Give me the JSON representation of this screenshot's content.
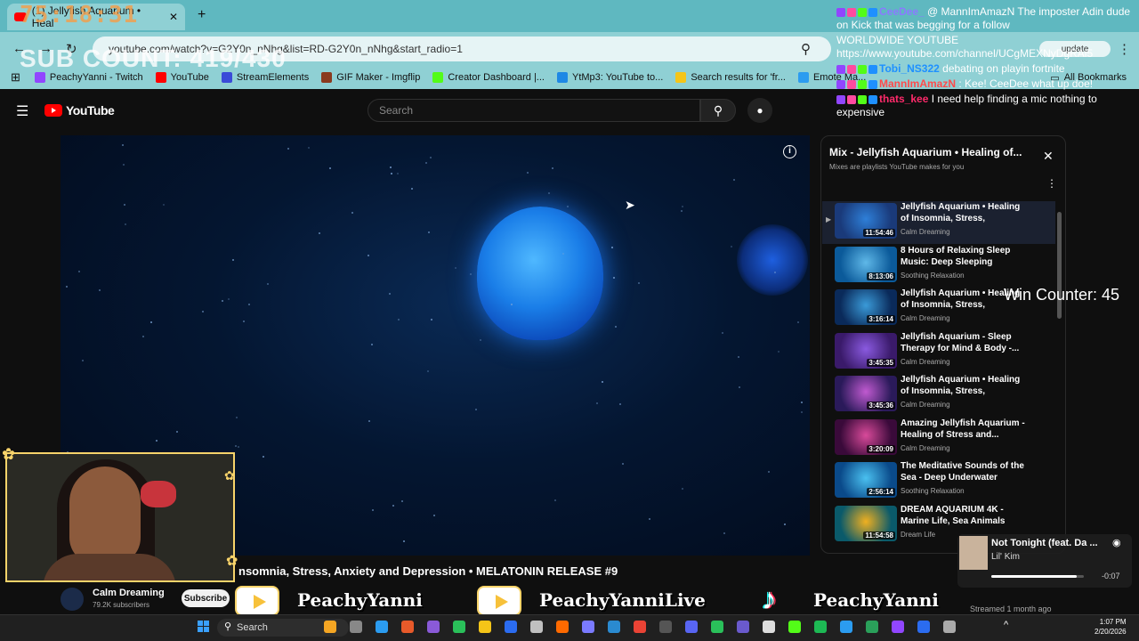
{
  "browser": {
    "tab_title": "(1) Jellyfish Aquarium • Heal",
    "url": "youtube.com/watch?v=G2Y0n_nNhg&list=RD-G2Y0n_nNhg&start_radio=1",
    "update_label": "update",
    "bookmarks": [
      {
        "label": "PeachyYanni - Twitch",
        "color": "#9146ff"
      },
      {
        "label": "YouTube",
        "color": "#ff0000"
      },
      {
        "label": "StreamElements",
        "color": "#3a4bd8"
      },
      {
        "label": "GIF Maker - Imgflip",
        "color": "#8a3a1e"
      },
      {
        "label": "Creator Dashboard |...",
        "color": "#53fc18"
      },
      {
        "label": "YtMp3: YouTube to...",
        "color": "#1e88e5"
      },
      {
        "label": "Search results for 'fr...",
        "color": "#f5c518"
      },
      {
        "label": "Emote Ma...",
        "color": "#2b9cf0"
      }
    ],
    "all_bookmarks": "All Bookmarks"
  },
  "youtube": {
    "logo_text": "YouTube",
    "search_placeholder": "Search",
    "video_title": "nsomnia, Stress, Anxiety and Depression • MELATONIN RELEASE #9",
    "channel_name": "Calm Dreaming",
    "channel_subs": "79.2K subscribers",
    "subscribe_label": "Subscribe"
  },
  "playlist": {
    "title": "Mix - Jellyfish Aquarium • Healing of...",
    "subtitle": "Mixes are playlists YouTube makes for you",
    "items": [
      {
        "title": "Jellyfish Aquarium • Healing of Insomnia, Stress, Anxiety...",
        "channel": "Calm Dreaming",
        "duration": "11:54:46",
        "c1": "#1a3a7a",
        "c2": "#2e7fd8"
      },
      {
        "title": "8 Hours of Relaxing Sleep Music: Deep Sleeping Music,...",
        "channel": "Soothing Relaxation",
        "duration": "8:13:06",
        "c1": "#0b5a9a",
        "c2": "#5fb8e8"
      },
      {
        "title": "Jellyfish Aquarium • Healing of Insomnia, Stress, Anxiety...",
        "channel": "Calm Dreaming",
        "duration": "3:16:14",
        "c1": "#0a2a5a",
        "c2": "#3a9ad8"
      },
      {
        "title": "Jellyfish Aquarium - Sleep Therapy for Mind & Body -...",
        "channel": "Calm Dreaming",
        "duration": "3:45:35",
        "c1": "#3a1a6a",
        "c2": "#8a5ae0"
      },
      {
        "title": "Jellyfish Aquarium • Healing of Insomnia, Stress, Anxiety...",
        "channel": "Calm Dreaming",
        "duration": "3:45:36",
        "c1": "#2a1a5a",
        "c2": "#c05ad0"
      },
      {
        "title": "Amazing Jellyfish Aquarium - Healing of Stress and...",
        "channel": "Calm Dreaming",
        "duration": "3:20:09",
        "c1": "#3a0a3a",
        "c2": "#d84a9a"
      },
      {
        "title": "The Meditative Sounds of the Sea - Deep Underwater",
        "channel": "Soothing Relaxation",
        "duration": "2:56:14",
        "c1": "#0a4a8a",
        "c2": "#4ac0f0"
      },
      {
        "title": "DREAM AQUARIUM 4K - Marine Life, Sea Animals and...",
        "channel": "Dream Life",
        "duration": "11:54:58",
        "c1": "#0a5a6a",
        "c2": "#f0b020"
      }
    ]
  },
  "overlay": {
    "timer": "75:18:31",
    "sub_count": "SUB COUNT: 419/430",
    "win_counter": "Win Counter: 45",
    "brand_1": "PeachyYanni",
    "brand_2": "PeachyYanniLive",
    "brand_3": "PeachyYanni",
    "streamed": "Streamed 1 month ago"
  },
  "chat": [
    {
      "name": "CeeDee_",
      "name_color": "#8a7aff",
      "text": " @ MannImAmazN The imposter Adin dude on Kick that was begging for a follow"
    },
    {
      "name": "",
      "name_color": "#ffffff",
      "text": "WORLDWIDE YOUTUBE https://www.youtube.com/channel/UCgMEXNyDgRAi5"
    },
    {
      "name": "Tobi_NS322",
      "name_color": "#1e90ff",
      "text": " debating on playin fortnite"
    },
    {
      "name": "MannImAmazN",
      "name_color": "#ff4a4a",
      "text": " : Kee! CeeDee what up doe!"
    },
    {
      "name": "thats_kee",
      "name_color": "#ff2a6a",
      "text": " I need help finding a mic nothing to expensive"
    }
  ],
  "now_playing": {
    "title": "Not Tonight (feat. Da ...",
    "artist": "Lil' Kim",
    "time": "-0:07",
    "progress": 0.92
  },
  "taskbar": {
    "search_label": "Search",
    "time": "1:07 PM",
    "date": "2/20/2026"
  }
}
